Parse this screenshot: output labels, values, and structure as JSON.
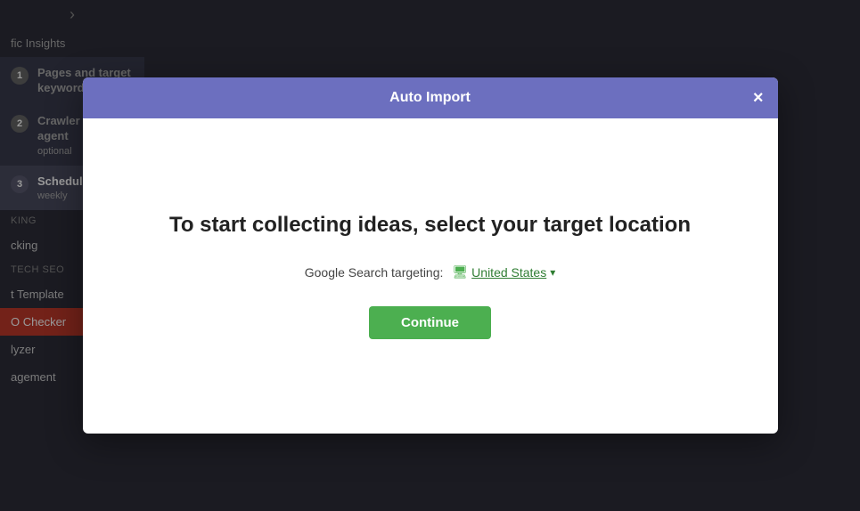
{
  "sidebar": {
    "chevron": "›",
    "traffic_insights": "fic Insights",
    "wizard_steps": [
      {
        "number": "1",
        "title": "Pages and target keywords",
        "subtitle": "",
        "state": "inactive"
      },
      {
        "number": "2",
        "title": "Crawler user agent",
        "subtitle": "optional",
        "state": "inactive"
      },
      {
        "number": "3",
        "title": "Schedule",
        "subtitle": "weekly",
        "state": "active"
      }
    ],
    "sections": [
      {
        "header": "KING",
        "items": [
          "cking"
        ]
      },
      {
        "header": "TECH SEO",
        "items": [
          "t Template",
          "O Checker",
          "lyzer",
          "agement"
        ]
      }
    ],
    "active_item": "O Checker"
  },
  "modal": {
    "title": "Auto Import",
    "close_label": "×",
    "heading": "To start collecting ideas, select your target location",
    "targeting_label": "Google Search targeting:",
    "location": "United States",
    "continue_label": "Continue"
  }
}
